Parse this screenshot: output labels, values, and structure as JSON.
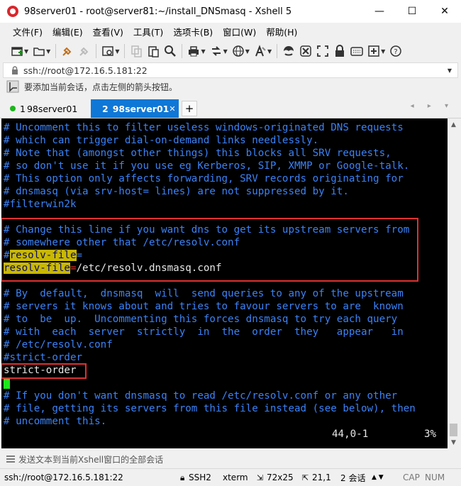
{
  "window": {
    "title": "98server01 - root@server81:~/install_DNSmasq - Xshell 5",
    "controls": {
      "minimize": "—",
      "maximize": "☐",
      "close": "✕"
    }
  },
  "menu": [
    "文件(F)",
    "编辑(E)",
    "查看(V)",
    "工具(T)",
    "选项卡(B)",
    "窗口(W)",
    "帮助(H)"
  ],
  "address": {
    "text": "ssh://root@172.16.5.181:22"
  },
  "hint": {
    "text": "要添加当前会话，点击左侧的箭头按钮。"
  },
  "tabs": [
    {
      "number": "1",
      "label": "98server01",
      "active": false
    },
    {
      "number": "2",
      "label": "98server01",
      "active": true
    }
  ],
  "tab_add": "+",
  "tab_nav": "◂ ▸ ▾",
  "terminal": {
    "lines": [
      "# Uncomment this to filter useless windows-originated DNS requests",
      "# which can trigger dial-on-demand links needlessly.",
      "# Note that (amongst other things) this blocks all SRV requests,",
      "# so don't use it if you use eg Kerberos, SIP, XMMP or Google-talk.",
      "# This option only affects forwarding, SRV records originating for",
      "# dnsmasq (via srv-host= lines) are not suppressed by it.",
      "#filterwin2k",
      "",
      "# Change this line if you want dns to get its upstream servers from",
      "# somewhere other that /etc/resolv.conf",
      "",
      "",
      "",
      "# By  default,  dnsmasq  will  send queries to any of the upstream",
      "# servers it knows about and tries to favour servers to are  known",
      "# to  be  up.  Uncommenting this forces dnsmasq to try each query",
      "# with  each  server  strictly  in  the  order  they   appear   in",
      "# /etc/resolv.conf",
      "#strict-order",
      "",
      "",
      "# If you don't want dnsmasq to read /etc/resolv.conf or any other",
      "# file, getting its servers from this file instead (see below), then",
      "# uncomment this."
    ],
    "resolv_comment": {
      "prefix": "#",
      "key": "resolv-file",
      "eq": "="
    },
    "resolv_active": {
      "key": "resolv-file",
      "eq": "=",
      "value": "/etc/resolv.dnsmasq.conf"
    },
    "strict_order": "strict-order",
    "position": "44,0-1",
    "percent": "3%"
  },
  "send_text_hint": "发送文本到当前Xshell窗口的全部会话",
  "statusbar": {
    "connection": "ssh://root@172.16.5.181:22",
    "protocol": "SSH2",
    "term": "xterm",
    "size": "72x25",
    "cursor": "21,1",
    "sessions": "2 会话",
    "caps": "CAP",
    "num": "NUM"
  },
  "colors": {
    "comment": "#3b82f6",
    "highlight": "#c9b800",
    "active_tab": "#0f77d6",
    "annotation_box": "#e03030",
    "cursor": "#1be71b"
  }
}
